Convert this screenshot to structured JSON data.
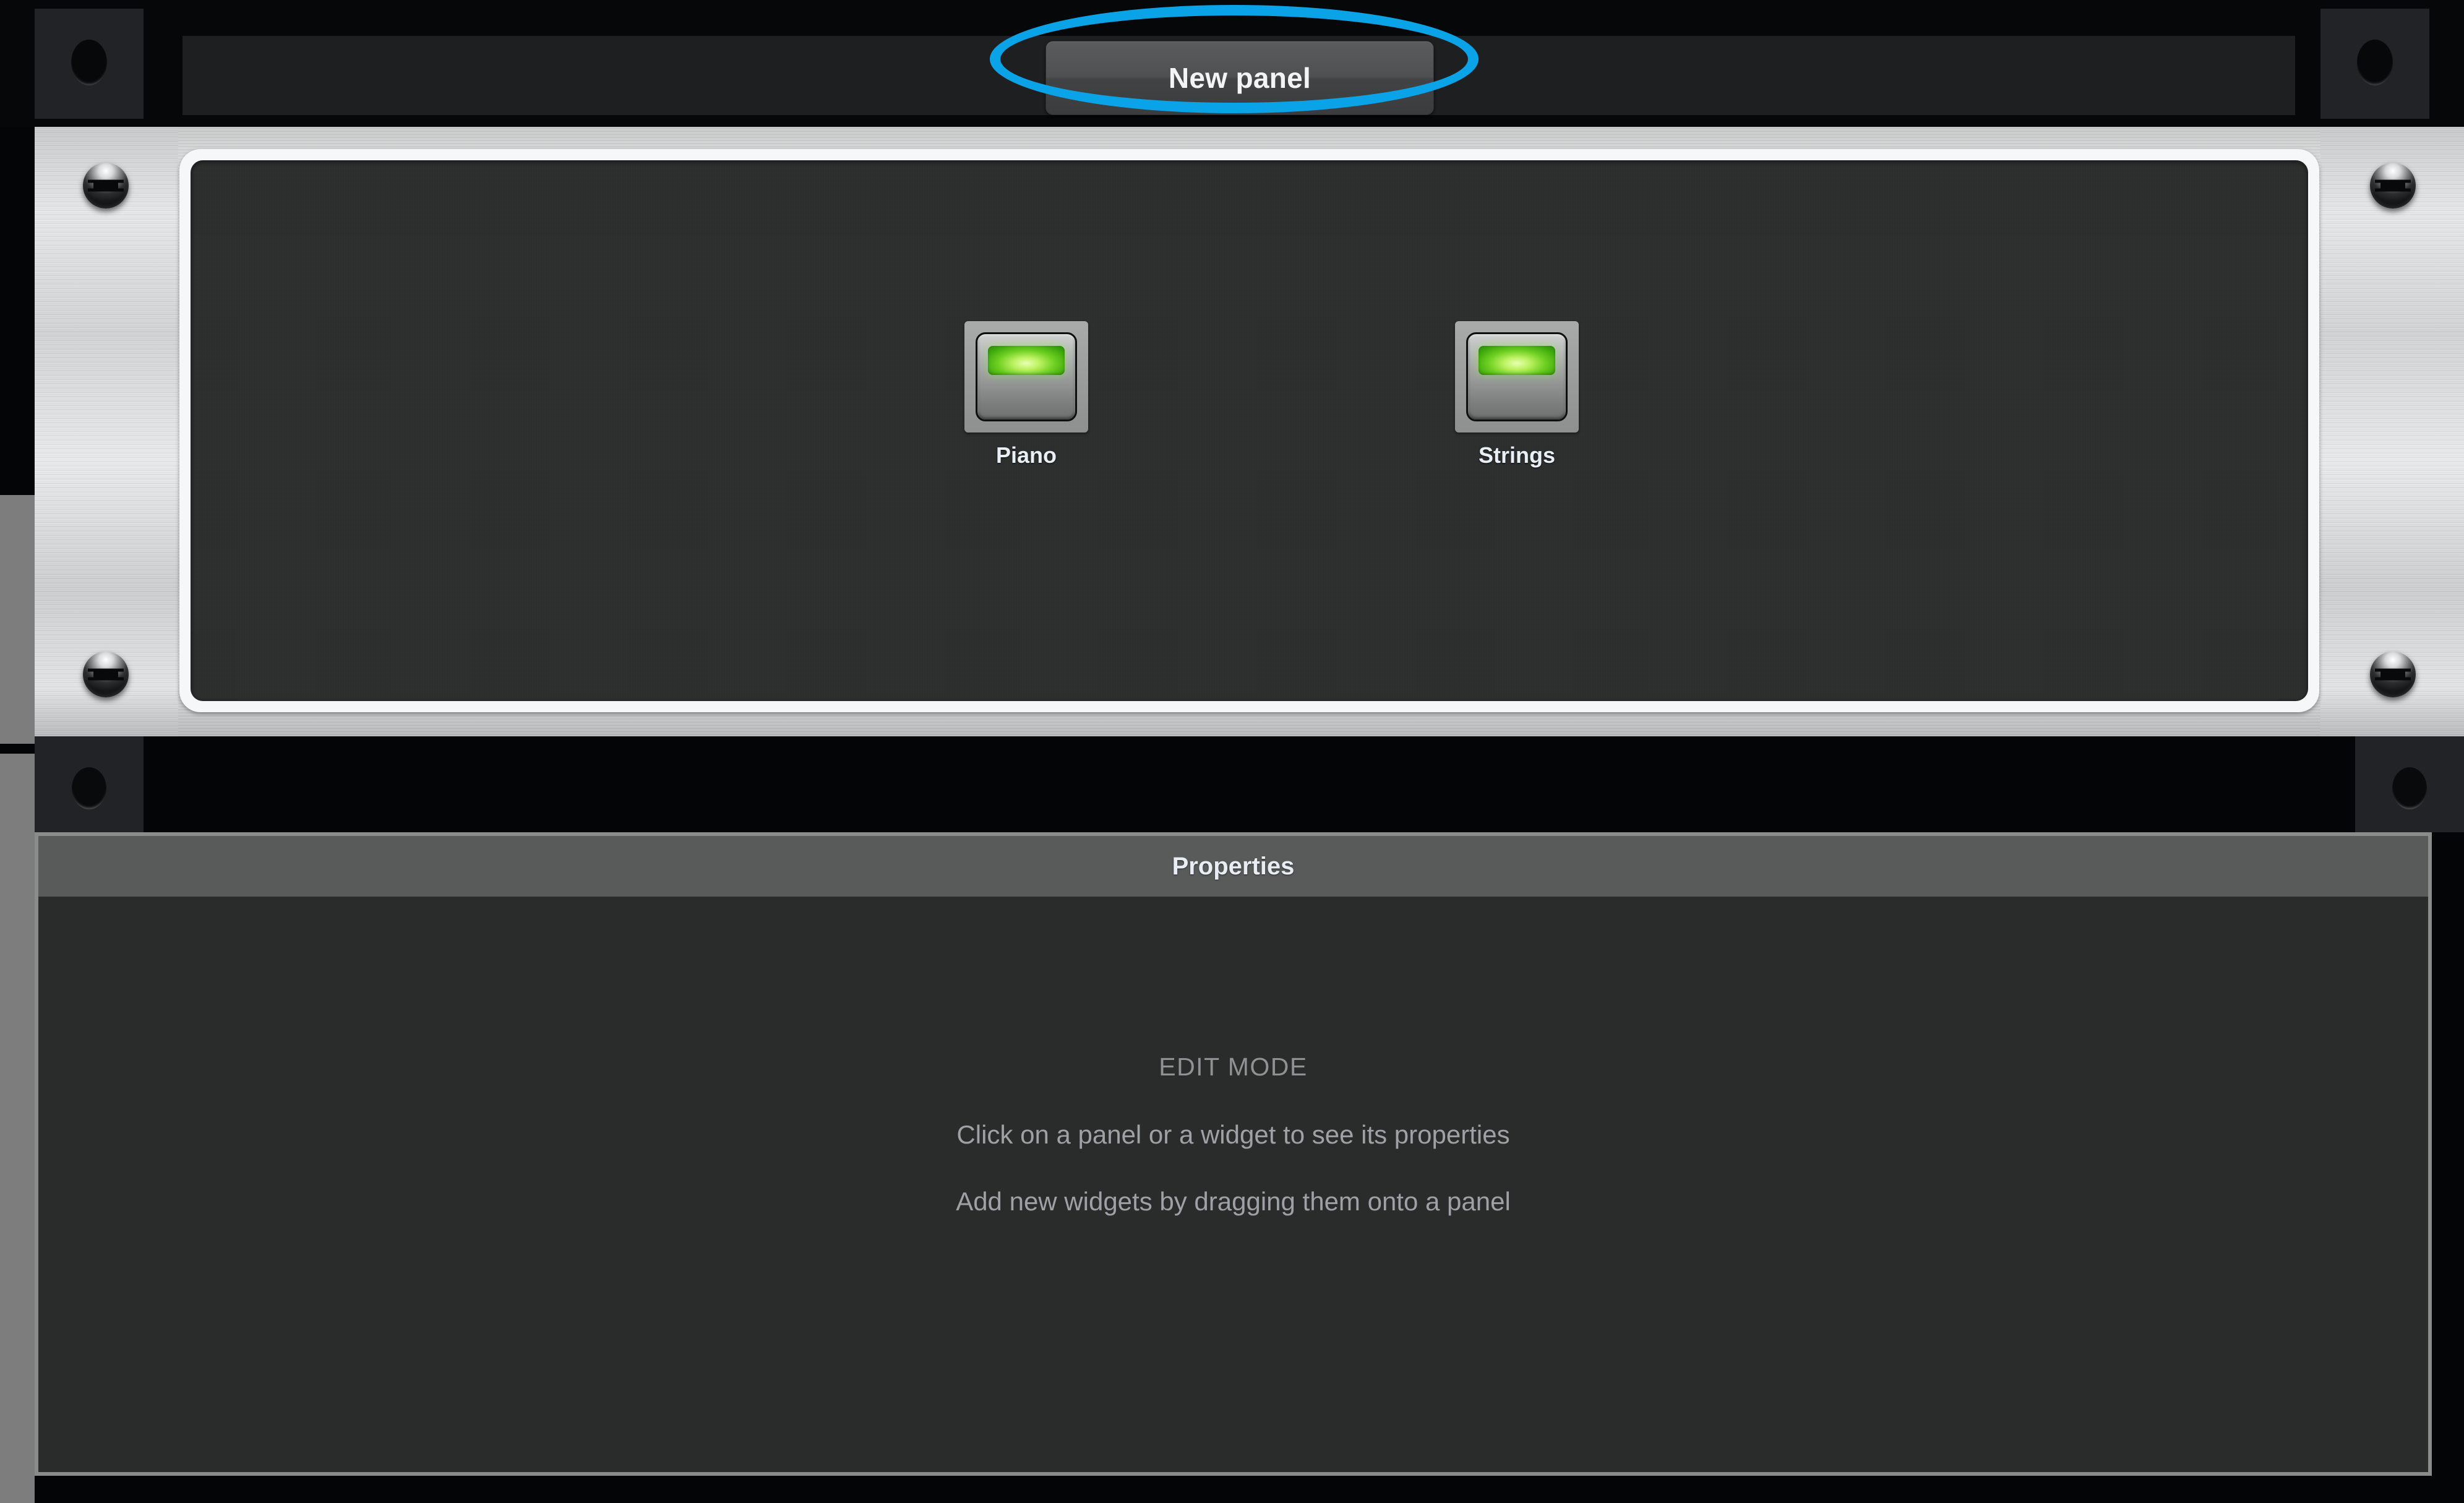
{
  "app": {
    "background_color": "#030506",
    "accent_annotation_color": "#0ba3e8",
    "metal_color": "#d8dada",
    "panel_bezel_color": "#f6f7f8"
  },
  "toolbar": {
    "new_panel_label": "New panel",
    "annotation": {
      "shape": "ellipse",
      "color": "#0ba3e8",
      "target": "New panel"
    }
  },
  "rack": {
    "screws": [
      "screw-top-left",
      "screw-bottom-left",
      "screw-top-right",
      "screw-bottom-right"
    ],
    "panel": {
      "widgets": [
        {
          "label": "Piano",
          "type": "led-button",
          "led_color": "#7fdc28",
          "state": "on"
        },
        {
          "label": "Strings",
          "type": "led-button",
          "led_color": "#7fdc28",
          "state": "on"
        }
      ]
    }
  },
  "properties": {
    "title": "Properties",
    "mode_label": "EDIT MODE",
    "hints": [
      "Click on a panel or a widget to see its properties",
      "Add new widgets by dragging them onto a panel"
    ]
  }
}
